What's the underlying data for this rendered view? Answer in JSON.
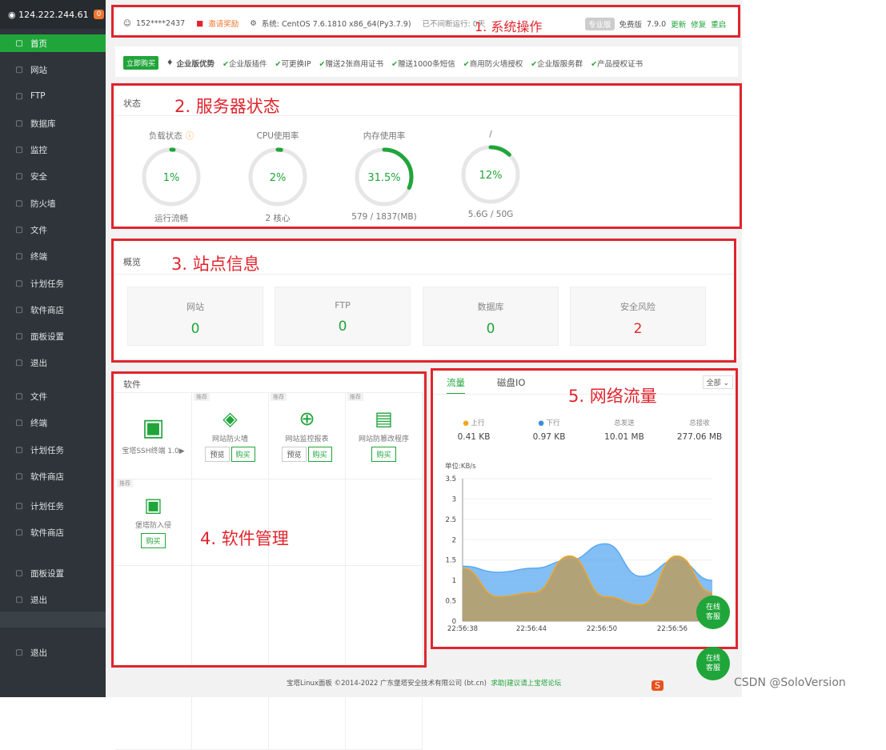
{
  "sidebar": {
    "ip": "124.222.244.61",
    "badge": "0",
    "items": [
      "首页",
      "网站",
      "FTP",
      "数据库",
      "监控",
      "安全",
      "防火墙",
      "文件",
      "终端",
      "计划任务",
      "软件商店",
      "面板设置",
      "退出",
      "文件",
      "终端",
      "计划任务",
      "软件商店",
      "计划任务",
      "软件商店",
      "面板设置",
      "退出",
      "退出"
    ]
  },
  "topbar": {
    "user": "152****2437",
    "invite": "邀请奖励",
    "system": "系统:  CentOS 7.6.1810 x86_64(Py3.7.9)",
    "uptime": "已不间断运行: 0天",
    "pro": "专业版",
    "free": "免费版",
    "version": "7.9.0",
    "update": "更新",
    "repair": "修复",
    "restart": "重启"
  },
  "promo": {
    "buy": "立即购买",
    "title": "企业版优势",
    "features": [
      "企业版插件",
      "可更换IP",
      "赠送2张商用证书",
      "赠送1000条短信",
      "商用防火墙授权",
      "企业版服务群",
      "产品授权证书"
    ]
  },
  "annotations": {
    "a1": "1. 系统操作",
    "a2": "2. 服务器状态",
    "a3": "3. 站点信息",
    "a4": "4. 软件管理",
    "a5": "5. 网络流量"
  },
  "status": {
    "title": "状态",
    "gauges": [
      {
        "label": "负载状态",
        "value": "1%",
        "pct": 1,
        "sub": "运行流畅"
      },
      {
        "label": "CPU使用率",
        "value": "2%",
        "pct": 2,
        "sub": "2 核心"
      },
      {
        "label": "内存使用率",
        "value": "31.5%",
        "pct": 31.5,
        "sub": "579 / 1837(MB)"
      },
      {
        "label": "/",
        "value": "12%",
        "pct": 12,
        "sub": "5.6G / 50G"
      }
    ]
  },
  "overview": {
    "title": "概览",
    "cards": [
      {
        "label": "网站",
        "value": "0",
        "color": "#20a53a"
      },
      {
        "label": "FTP",
        "value": "0",
        "color": "#20a53a"
      },
      {
        "label": "数据库",
        "value": "0",
        "color": "#20a53a"
      },
      {
        "label": "安全风险",
        "value": "2",
        "color": "#e0252d"
      }
    ]
  },
  "software": {
    "title": "软件",
    "rec": "推荐",
    "preview": "预览",
    "buy": "购买",
    "items": [
      {
        "name": "宝塔SSH终端 1.0▶"
      },
      {
        "name": "网站防火墙"
      },
      {
        "name": "网站监控报表"
      },
      {
        "name": "网站防篡改程序"
      },
      {
        "name": "堡塔防入侵"
      }
    ]
  },
  "network": {
    "tabs": [
      "流量",
      "磁盘IO"
    ],
    "select": "全部",
    "stats": [
      {
        "label": "上行",
        "value": "0.41 KB",
        "color": "#f5a623"
      },
      {
        "label": "下行",
        "value": "0.97 KB",
        "color": "#3c8dde"
      },
      {
        "label": "总发送",
        "value": "10.01 MB"
      },
      {
        "label": "总接收",
        "value": "277.06 MB"
      }
    ],
    "unit": "单位:KB/s"
  },
  "chart_data": {
    "type": "area",
    "x": [
      "22:56:38",
      "22:56:44",
      "22:56:50",
      "22:56:56"
    ],
    "yticks": [
      "0",
      "0.5",
      "1",
      "1.5",
      "2",
      "2.5",
      "3",
      "3.5"
    ],
    "ylim": [
      0,
      3.5
    ],
    "series": [
      {
        "name": "上行",
        "color": "#f5a623",
        "values": [
          1.3,
          0.6,
          0.7,
          1.6,
          0.6,
          0.4,
          1.6,
          0.7
        ]
      },
      {
        "name": "下行",
        "color": "#5aa9f0",
        "values": [
          1.35,
          1.2,
          1.3,
          1.5,
          1.9,
          1.1,
          1.5,
          1.0
        ]
      }
    ]
  },
  "float": {
    "text": "在线\n客服"
  },
  "footer": {
    "copy": "宝塔Linux面板 ©2014-2022 广东堡塔安全技术有限公司 (bt.cn)",
    "link": "求助|建议请上宝塔论坛"
  },
  "watermark": "CSDN @SoloVersion"
}
